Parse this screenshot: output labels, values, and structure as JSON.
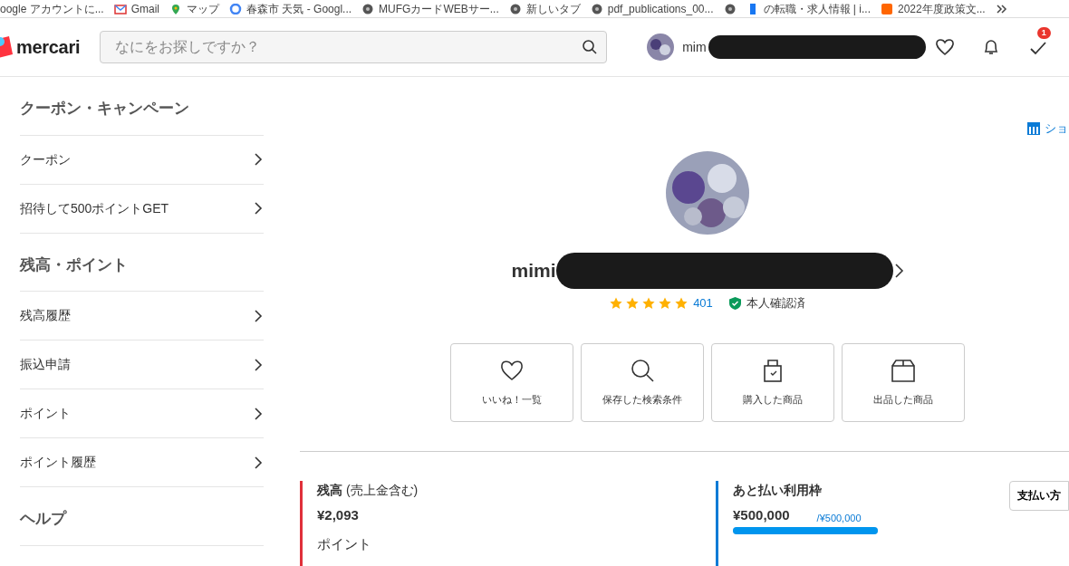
{
  "bookmarks": [
    {
      "label": "oogle アカウントに...",
      "kind": "plain"
    },
    {
      "label": "Gmail",
      "kind": "mail"
    },
    {
      "label": "マップ",
      "kind": "pin"
    },
    {
      "label": "春森市 天気 - Googl...",
      "kind": "g"
    },
    {
      "label": "MUFGカードWEBサー...",
      "kind": "globe"
    },
    {
      "label": "新しいタブ",
      "kind": "globe"
    },
    {
      "label": "pdf_publications_00...",
      "kind": "globe"
    },
    {
      "kind": "globe"
    },
    {
      "label": "の転職・求人情報 | i...",
      "kind": "f"
    },
    {
      "label": "2022年度政策文...",
      "kind": "box"
    }
  ],
  "header": {
    "logo": "mercari",
    "search": {
      "placeholder": "なにをお探しですか？"
    },
    "user": "mim",
    "badge": "1"
  },
  "sidebar": [
    {
      "heading": "クーポン・キャンペーン",
      "items": [
        "クーポン",
        "招待して500ポイントGET"
      ]
    },
    {
      "heading": "残高・ポイント",
      "items": [
        "残高履歴",
        "振込申請",
        "ポイント",
        "ポイント履歴"
      ]
    },
    {
      "heading": "ヘルプ"
    }
  ],
  "shop_link": "ショ",
  "profile": {
    "name": "mimi",
    "stars": 5,
    "rating_count": "401",
    "verified": "本人確認済"
  },
  "tiles": [
    {
      "label": "いいね！一覧",
      "kind": "heart"
    },
    {
      "label": "保存した検索条件",
      "kind": "search"
    },
    {
      "label": "購入した商品",
      "kind": "bag"
    },
    {
      "label": "出品した商品",
      "kind": "box"
    }
  ],
  "balance": {
    "title": "残高",
    "title_note": "(売上金含む)",
    "amount": "¥2,093",
    "points_label": "ポイント"
  },
  "credit": {
    "title": "あと払い利用枠",
    "amount": "¥500,000",
    "limit": "/¥500,000",
    "level": 1,
    "button": "支払い方"
  }
}
